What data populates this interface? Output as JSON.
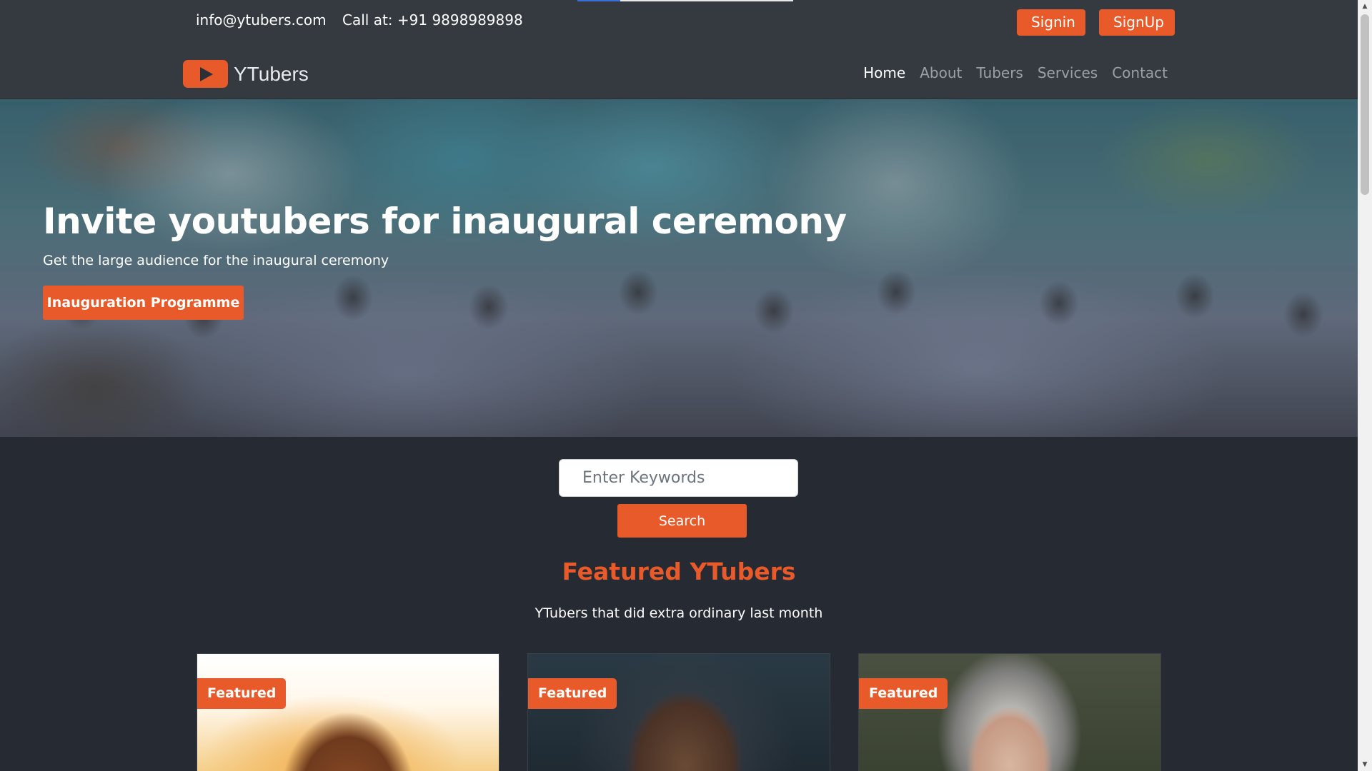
{
  "topbar": {
    "email": "info@ytubers.com",
    "phone": "Call at: +91 9898989898",
    "signin_label": "Signin",
    "signup_label": "SignUp"
  },
  "navbar": {
    "brand": "YTubers",
    "links": [
      "Home",
      "About",
      "Tubers",
      "Services",
      "Contact"
    ],
    "active": "Home"
  },
  "hero": {
    "title": "Invite youtubers for inaugural ceremony",
    "subtitle": "Get the large audience for the inaugural ceremony",
    "button_label": "Inauguration Programme"
  },
  "search": {
    "placeholder": "Enter Keywords",
    "button_label": "Search"
  },
  "featured": {
    "title": "Featured YTubers",
    "subtitle": "YTubers that did extra ordinary last month",
    "cards": [
      {
        "badge": "Featured"
      },
      {
        "badge": "Featured"
      },
      {
        "badge": "Featured"
      }
    ]
  },
  "colors": {
    "accent": "#e85a2a",
    "navbar": "#343a40",
    "page_background": "#262a33"
  }
}
